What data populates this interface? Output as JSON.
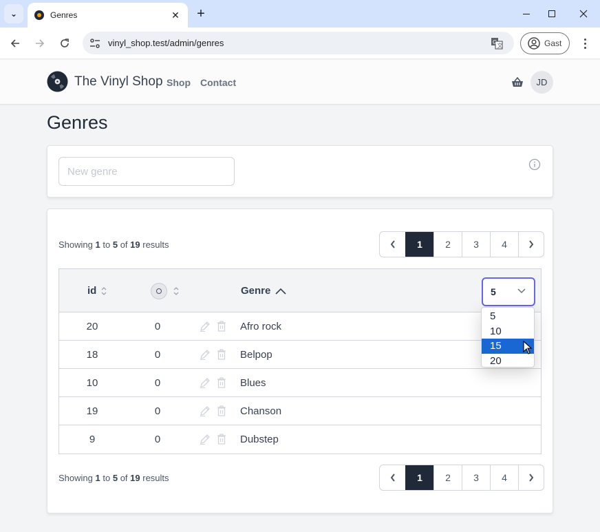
{
  "browser": {
    "tab_title": "Genres",
    "url": "vinyl_shop.test/admin/genres",
    "profile_label": "Gast",
    "icons": {
      "tab_menu": "chevron-down-icon",
      "close_tab": "close-icon",
      "new_tab": "plus-icon",
      "back": "arrow-left-icon",
      "forward": "arrow-right-icon",
      "reload": "reload-icon",
      "site_info": "tune-icon",
      "translate": "translate-icon",
      "profile": "account-circle-icon",
      "menu": "kebab-menu-icon",
      "minimize": "minimize-icon",
      "maximize": "maximize-icon",
      "close_window": "close-icon"
    },
    "glyphs": {
      "chevron": "⌄",
      "close": "✕",
      "plus": "+",
      "back": "←",
      "forward": "→",
      "reload": "↻",
      "minimize": "—",
      "maximize": "☐"
    }
  },
  "nav": {
    "brand": "The Vinyl Shop",
    "links": [
      {
        "label": "Shop"
      },
      {
        "label": "Contact"
      }
    ],
    "avatar_initials": "JD",
    "icons": {
      "logo": "vinyl-record-icon",
      "basket": "basket-icon"
    }
  },
  "page": {
    "title": "Genres"
  },
  "create_form": {
    "placeholder": "New genre",
    "value": "",
    "info_icon": "info-icon"
  },
  "pagination": {
    "showing_prefix": "Showing",
    "from": "1",
    "to_word": "to",
    "to": "5",
    "of_word": "of",
    "total": "19",
    "results_word": "results",
    "prev": "‹",
    "next": "›",
    "pages": [
      "1",
      "2",
      "3",
      "4"
    ],
    "current_page": "1"
  },
  "table": {
    "columns": {
      "id": "id",
      "records": "records-count-icon",
      "genre": "Genre"
    },
    "sort": {
      "column": "Genre",
      "direction": "ascending"
    },
    "per_page": {
      "selected": "5",
      "options": [
        "5",
        "10",
        "15",
        "20"
      ],
      "highlighted": "15",
      "open": true
    },
    "rows": [
      {
        "id": "20",
        "records": "0",
        "genre": "Afro rock"
      },
      {
        "id": "18",
        "records": "0",
        "genre": "Belpop"
      },
      {
        "id": "10",
        "records": "0",
        "genre": "Blues"
      },
      {
        "id": "19",
        "records": "0",
        "genre": "Chanson"
      },
      {
        "id": "9",
        "records": "0",
        "genre": "Dubstep"
      }
    ],
    "row_actions": [
      "edit-icon",
      "trash-icon"
    ]
  },
  "colors": {
    "primary_dark": "#1f2937",
    "focus_ring": "#6366f1",
    "selected_option": "#1967d2",
    "tabstrip": "#d3e3fd"
  }
}
